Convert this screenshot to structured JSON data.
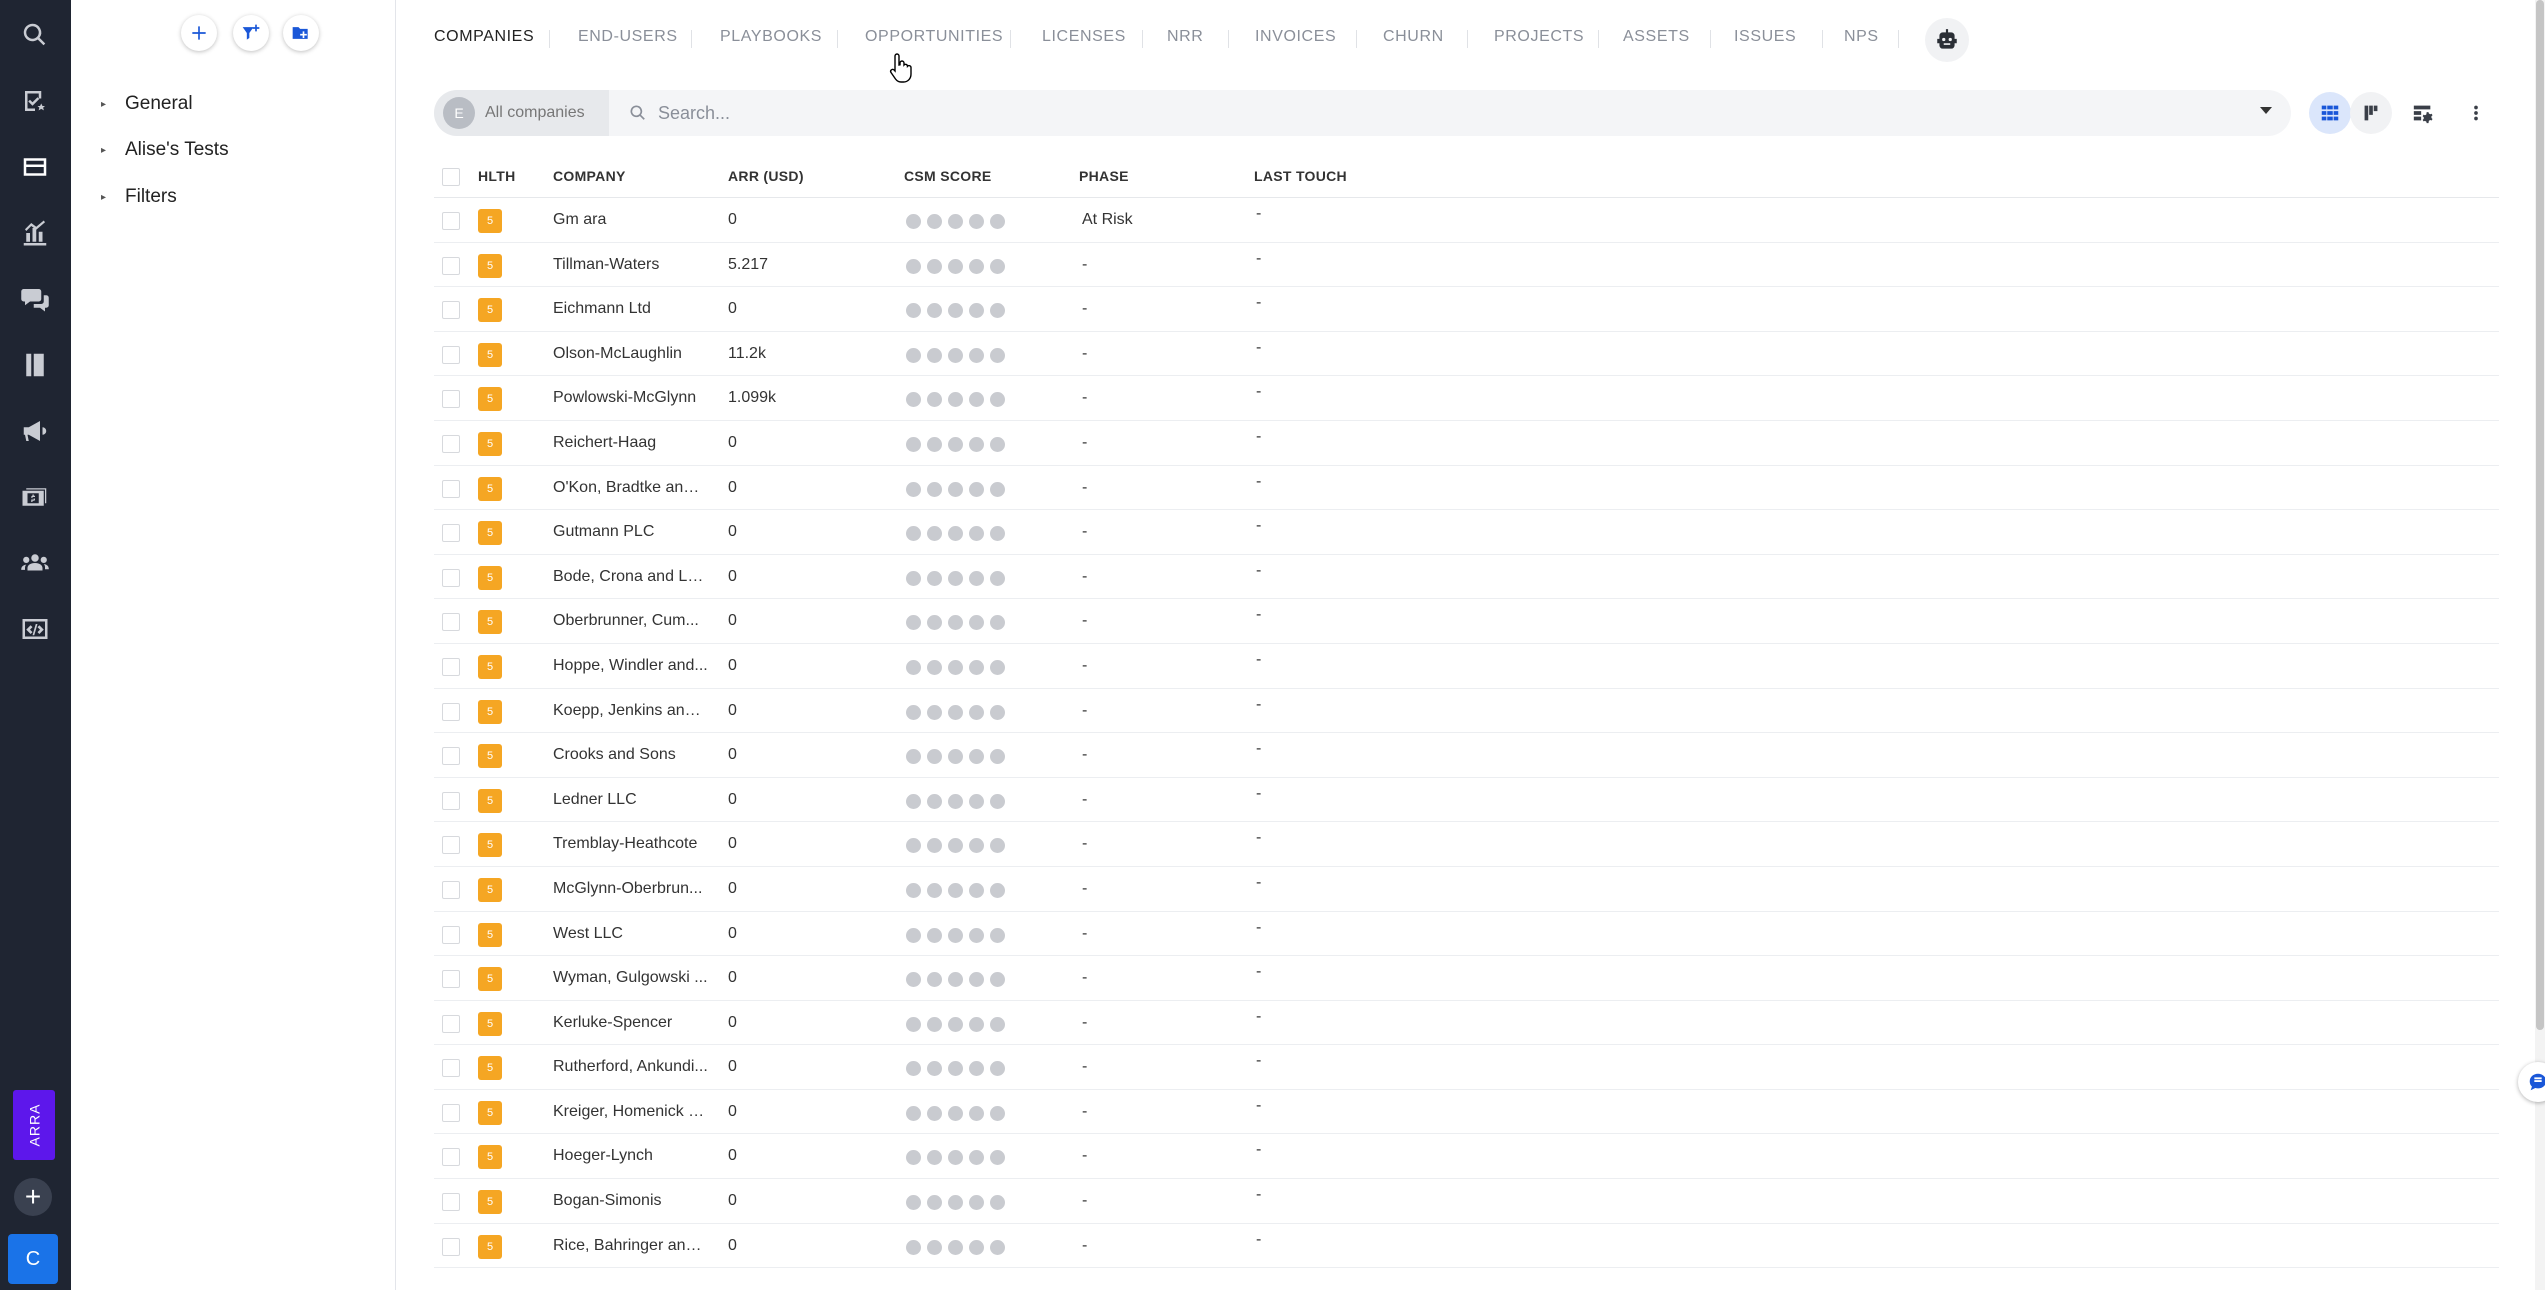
{
  "rail": {
    "icons": [
      "search-icon",
      "tasks-icon",
      "companies-icon",
      "analytics-icon",
      "conversations-icon",
      "playbooks-icon",
      "campaigns-icon",
      "billing-icon",
      "users-icon",
      "code-icon"
    ],
    "arra_label": "ARRA",
    "add_label": "+",
    "avatar_initial": "C"
  },
  "panel": {
    "actions": [
      "add-icon",
      "filter-plus-icon",
      "add-folder-icon"
    ],
    "tree": [
      {
        "label": "General"
      },
      {
        "label": "Alise's Tests"
      },
      {
        "label": "Filters"
      }
    ]
  },
  "tabs": [
    {
      "label": "COMPANIES",
      "active": true
    },
    {
      "label": "END-USERS"
    },
    {
      "label": "PLAYBOOKS"
    },
    {
      "label": "OPPORTUNITIES"
    },
    {
      "label": "LICENSES"
    },
    {
      "label": "NRR"
    },
    {
      "label": "INVOICES"
    },
    {
      "label": "CHURN"
    },
    {
      "label": "PROJECTS"
    },
    {
      "label": "ASSETS"
    },
    {
      "label": "ISSUES"
    },
    {
      "label": "NPS"
    }
  ],
  "search": {
    "segment_initial": "E",
    "segment_label": "All companies",
    "placeholder": "Search...",
    "value": ""
  },
  "table": {
    "headers": {
      "health": "HLTH",
      "company": "COMPANY",
      "arr": "ARR (USD)",
      "csm_score": "CSM SCORE",
      "phase": "PHASE",
      "last_touch": "LAST TOUCH"
    },
    "rows": [
      {
        "health": "5",
        "company": "Gm ara",
        "arr": "0",
        "phase": "At Risk",
        "last_touch": "-"
      },
      {
        "health": "5",
        "company": "Tillman-Waters",
        "arr": "5.217",
        "phase": "-",
        "last_touch": "-"
      },
      {
        "health": "5",
        "company": "Eichmann Ltd",
        "arr": "0",
        "phase": "-",
        "last_touch": "-"
      },
      {
        "health": "5",
        "company": "Olson-McLaughlin",
        "arr": "11.2k",
        "phase": "-",
        "last_touch": "-"
      },
      {
        "health": "5",
        "company": "Powlowski-McGlynn",
        "arr": "1.099k",
        "phase": "-",
        "last_touch": "-"
      },
      {
        "health": "5",
        "company": "Reichert-Haag",
        "arr": "0",
        "phase": "-",
        "last_touch": "-"
      },
      {
        "health": "5",
        "company": "O'Kon, Bradtke and ...",
        "arr": "0",
        "phase": "-",
        "last_touch": "-"
      },
      {
        "health": "5",
        "company": "Gutmann PLC",
        "arr": "0",
        "phase": "-",
        "last_touch": "-"
      },
      {
        "health": "5",
        "company": "Bode, Crona and Le...",
        "arr": "0",
        "phase": "-",
        "last_touch": "-"
      },
      {
        "health": "5",
        "company": "Oberbrunner, Cum...",
        "arr": "0",
        "phase": "-",
        "last_touch": "-"
      },
      {
        "health": "5",
        "company": "Hoppe, Windler and...",
        "arr": "0",
        "phase": "-",
        "last_touch": "-"
      },
      {
        "health": "5",
        "company": "Koepp, Jenkins and ...",
        "arr": "0",
        "phase": "-",
        "last_touch": "-"
      },
      {
        "health": "5",
        "company": "Crooks and Sons",
        "arr": "0",
        "phase": "-",
        "last_touch": "-"
      },
      {
        "health": "5",
        "company": "Ledner LLC",
        "arr": "0",
        "phase": "-",
        "last_touch": "-"
      },
      {
        "health": "5",
        "company": "Tremblay-Heathcote",
        "arr": "0",
        "phase": "-",
        "last_touch": "-"
      },
      {
        "health": "5",
        "company": "McGlynn-Oberbrun...",
        "arr": "0",
        "phase": "-",
        "last_touch": "-"
      },
      {
        "health": "5",
        "company": "West LLC",
        "arr": "0",
        "phase": "-",
        "last_touch": "-"
      },
      {
        "health": "5",
        "company": "Wyman, Gulgowski ...",
        "arr": "0",
        "phase": "-",
        "last_touch": "-"
      },
      {
        "health": "5",
        "company": "Kerluke-Spencer",
        "arr": "0",
        "phase": "-",
        "last_touch": "-"
      },
      {
        "health": "5",
        "company": "Rutherford, Ankundi...",
        "arr": "0",
        "phase": "-",
        "last_touch": "-"
      },
      {
        "health": "5",
        "company": "Kreiger, Homenick a...",
        "arr": "0",
        "phase": "-",
        "last_touch": "-"
      },
      {
        "health": "5",
        "company": "Hoeger-Lynch",
        "arr": "0",
        "phase": "-",
        "last_touch": "-"
      },
      {
        "health": "5",
        "company": "Bogan-Simonis",
        "arr": "0",
        "phase": "-",
        "last_touch": "-"
      },
      {
        "health": "5",
        "company": "Rice, Bahringer and ...",
        "arr": "0",
        "phase": "-",
        "last_touch": "-"
      }
    ]
  },
  "colors": {
    "rail_bg": "#1f2532",
    "accent": "#1a57d8",
    "health_badge": "#f5a623",
    "arra_badge": "#5d17eb"
  }
}
